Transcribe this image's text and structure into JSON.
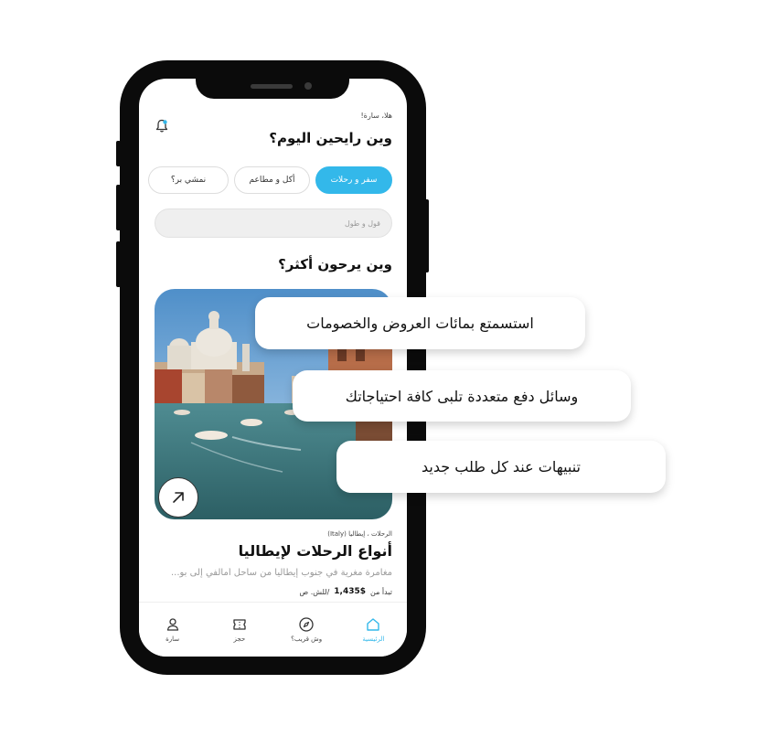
{
  "greeting": {
    "small": "هلا، سارة!",
    "title": "وين رايحين اليوم؟"
  },
  "categories": [
    {
      "label": "سفر و رحلات",
      "active": true
    },
    {
      "label": "أكل و مطاعم",
      "active": false
    },
    {
      "label": "نمشي بر؟",
      "active": false
    }
  ],
  "search": {
    "placeholder": "قول و طول"
  },
  "section": {
    "title": "وين يرحون أكثر؟"
  },
  "trip": {
    "breadcrumb": "الرحلات ، إيطاليا (Italy)",
    "title": "أنواع الرحلات لإيطاليا",
    "description": "مغامرة مغرية في جنوب إيطاليا من ساحل أمالفي إلى بو...",
    "price_prefix": "تبدأ من",
    "price": "1,435$",
    "price_unit": "/للش. ص"
  },
  "tabs": [
    {
      "label": "الرئيسية",
      "icon": "home-icon",
      "active": true
    },
    {
      "label": "وش قريب؟",
      "icon": "compass-icon",
      "active": false
    },
    {
      "label": "حجز",
      "icon": "ticket-icon",
      "active": false
    },
    {
      "label": "سارة",
      "icon": "user-icon",
      "active": false
    }
  ],
  "callouts": [
    "استسمتع بمائات العروض والخصومات",
    "وسائل دفع متعددة تلبى كافة احتياجاتك",
    "تنبيهات عند كل طلب جديد"
  ],
  "colors": {
    "accent": "#33b8ea",
    "phone": "#0b0b0b"
  }
}
